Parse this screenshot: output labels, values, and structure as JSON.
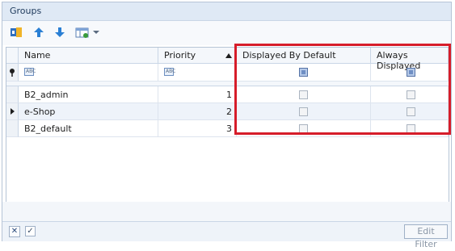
{
  "panel": {
    "title": "Groups"
  },
  "toolbar": {
    "icons": [
      "group-properties-icon",
      "arrow-up-icon",
      "arrow-down-icon",
      "grid-view-icon",
      "dropdown-caret-icon"
    ]
  },
  "grid": {
    "columns": [
      {
        "label": "Name"
      },
      {
        "label": "Priority",
        "sort": "ascending"
      },
      {
        "label": "Displayed By Default"
      },
      {
        "label": "Always Displayed"
      }
    ],
    "filter_row": {
      "name_placeholder": "ABC",
      "priority_placeholder": "ABC"
    },
    "rows": [
      {
        "name": "B2_admin",
        "priority": "1",
        "displayed_by_default": false,
        "always_displayed": false,
        "current": false
      },
      {
        "name": "e-Shop",
        "priority": "2",
        "displayed_by_default": false,
        "always_displayed": false,
        "current": true
      },
      {
        "name": "B2_default",
        "priority": "3",
        "displayed_by_default": false,
        "always_displayed": false,
        "current": false
      }
    ]
  },
  "footer": {
    "close_glyph": "✕",
    "check_glyph": "✓",
    "edit_filter_label": "Edit Filter"
  },
  "highlight": {
    "color": "#d61d2a"
  }
}
